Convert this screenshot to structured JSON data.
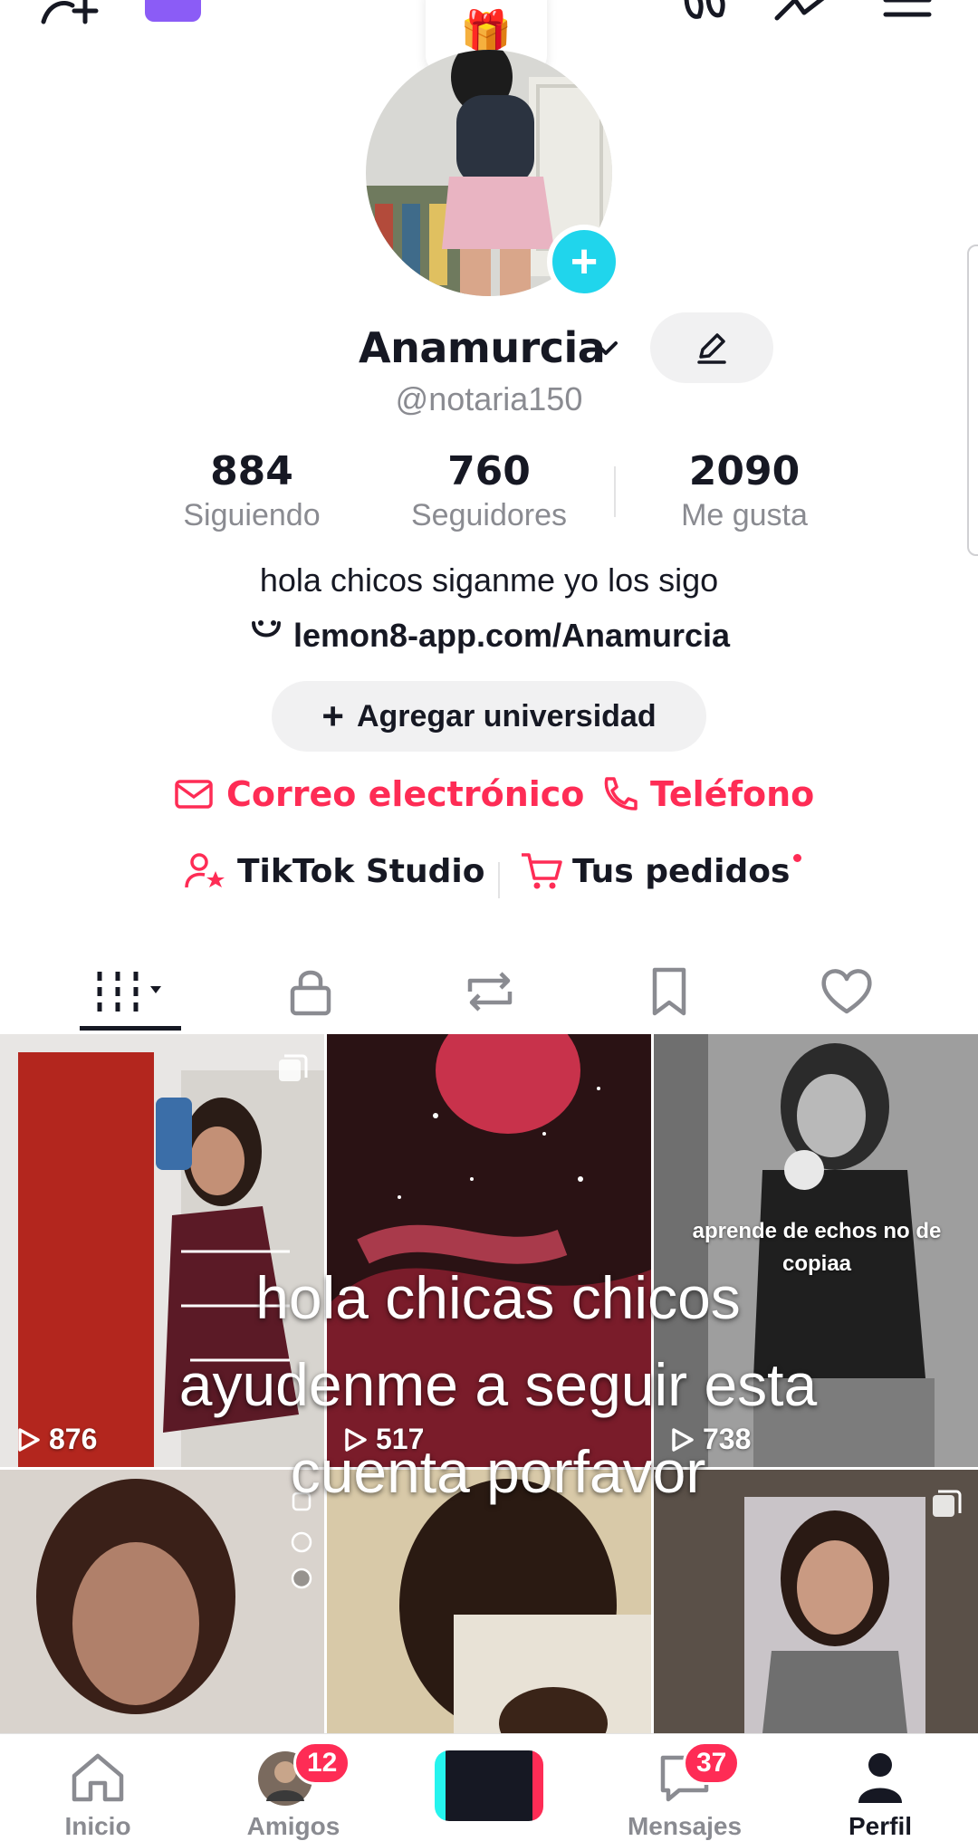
{
  "topbar": {
    "icons": [
      "add-friend-icon",
      "music-badge-icon",
      "gift-icon",
      "footprint-icon",
      "stats-icon",
      "menu-icon"
    ]
  },
  "profile": {
    "display_name": "Anamurcia",
    "handle": "@notaria150",
    "stats": [
      {
        "value": "884",
        "label": "Siguiendo"
      },
      {
        "value": "760",
        "label": "Seguidores"
      },
      {
        "value": "2090",
        "label": "Me gusta"
      }
    ],
    "bio": "hola chicos siganme yo los sigo",
    "link": "lemon8-app.com/Anamurcia",
    "add_university": "Agregar universidad",
    "email_label": "Correo electrónico",
    "phone_label": "Teléfono",
    "studio_label": "TikTok Studio",
    "orders_label": "Tus pedidos"
  },
  "tabs": [
    "videos-grid-icon",
    "lock-icon",
    "repost-icon",
    "bookmark-icon",
    "heart-icon"
  ],
  "videos": [
    {
      "views": "876"
    },
    {
      "views": "517"
    },
    {
      "views": "738",
      "caption": "aprende de echos no de copiaa"
    },
    {
      "views": ""
    },
    {
      "views": ""
    },
    {
      "views": ""
    }
  ],
  "overlay_caption": "hola chicas chicos ayudenme a seguir esta cuenta porfavor",
  "nav": {
    "home": "Inicio",
    "friends": "Amigos",
    "friends_badge": "12",
    "messages": "Mensajes",
    "messages_badge": "37",
    "profile": "Perfil"
  },
  "colors": {
    "accent": "#fe2c55",
    "add_button": "#20d5ec",
    "text": "#161823",
    "muted": "#8a8b91"
  }
}
